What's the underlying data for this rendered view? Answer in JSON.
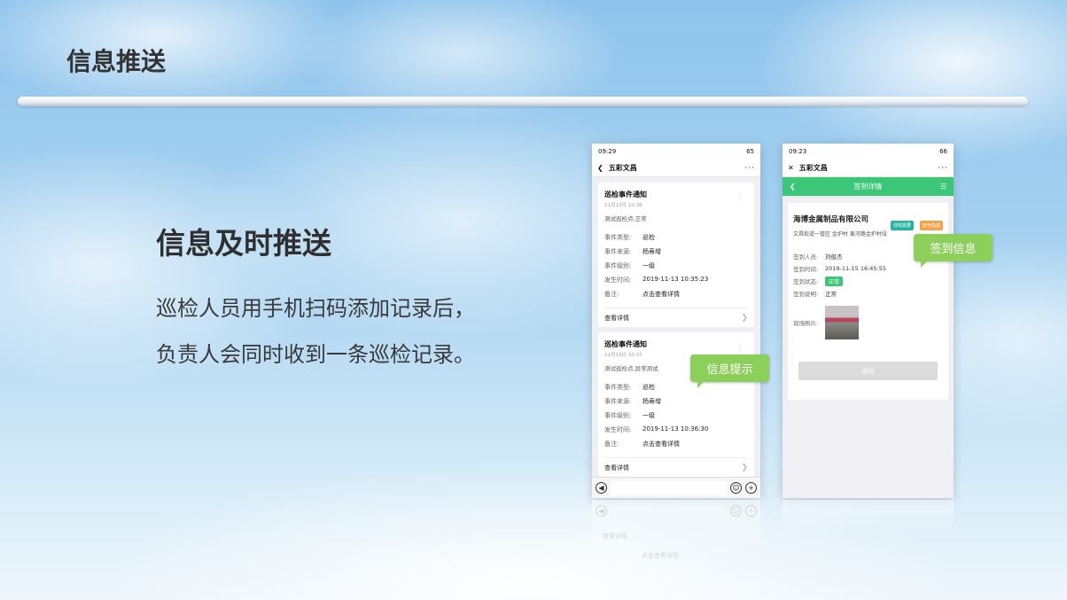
{
  "slide": {
    "title": "信息推送",
    "headline": "信息及时推送",
    "desc_line1": "巡检人员用手机扫码添加记录后，",
    "desc_line2": "负责人会同时收到一条巡检记录。"
  },
  "phone_a": {
    "status_time": "09:29",
    "status_right": "65",
    "nav_title": "五彩文昌",
    "cards": [
      {
        "title": "巡检事件通知",
        "date": "11月13日 10:36",
        "desc": "测试巡检点,正常",
        "fields": [
          {
            "k": "事件类型:",
            "v": "巡检"
          },
          {
            "k": "事件来源:",
            "v": "杨寿增"
          },
          {
            "k": "事件级别:",
            "v": "一级"
          },
          {
            "k": "发生时间:",
            "v": "2019-11-13 10:35:23"
          },
          {
            "k": "备注:",
            "v": "点击查看详情"
          }
        ],
        "footer": "查看详情"
      },
      {
        "title": "巡检事件通知",
        "date": "11月13日 10:37",
        "desc": "测试巡检点,异常测试",
        "fields": [
          {
            "k": "事件类型:",
            "v": "巡检"
          },
          {
            "k": "事件来源:",
            "v": "杨寿增"
          },
          {
            "k": "事件级别:",
            "v": "一级"
          },
          {
            "k": "发生时间:",
            "v": "2019-11-13 10:36:30"
          },
          {
            "k": "备注:",
            "v": "点击查看详情"
          }
        ],
        "footer": "查看详情"
      }
    ],
    "reflection_footer": "查看详情",
    "reflection_note": "点击查看详情"
  },
  "phone_b": {
    "status_time": "09:23",
    "status_right": "66",
    "nav_title": "五彩文昌",
    "page_title": "签到详情",
    "company": "海博金属制品有限公司",
    "tag1": "详情需要",
    "tag2": "安全隐患",
    "address": "文昌街道一管区 金炉村 黄河路金炉村段",
    "fields": [
      {
        "k": "签到人员:",
        "v": "刘俊杰"
      },
      {
        "k": "签到时间:",
        "v": "2019-11-15 16:45:55"
      }
    ],
    "status_label": "签到状态:",
    "status_value": "正常",
    "remark_label": "签到说明:",
    "remark_value": "正常",
    "photo_label": "现场照片:",
    "return_label": "返回"
  },
  "bubbles": {
    "info": "信息提示",
    "sign": "签到信息"
  },
  "colors": {
    "green": "#3cc678",
    "bubble_green": "#8ccf5a",
    "tag_teal": "#26b3a4",
    "tag_orange": "#f2a24a"
  },
  "icons": [
    "back-chevron-icon",
    "more-icon",
    "close-icon",
    "list-icon",
    "voice-icon",
    "emoji-icon",
    "plus-icon"
  ]
}
